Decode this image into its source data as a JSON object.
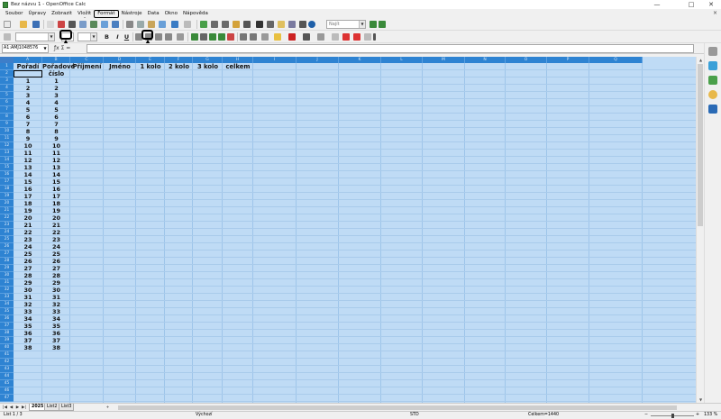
{
  "window": {
    "title": "Bez názvu 1 - OpenOffice Calc",
    "minimize": "—",
    "maximize": "□",
    "close": "✕",
    "doc_close": "×"
  },
  "menu": [
    "Soubor",
    "Úpravy",
    "Zobrazit",
    "Vložit",
    "Formát",
    "Nástroje",
    "Data",
    "Okno",
    "Nápověda"
  ],
  "highlighted_menu": "Formát",
  "toolbar": {
    "find_placeholder": "Najít"
  },
  "format_buttons": {
    "bold": "B",
    "italic": "I",
    "underline": "U"
  },
  "formula_bar": {
    "name_box": "A1:AMJ1048576",
    "fx": "ƒx Σ ="
  },
  "columns": [
    "A",
    "B",
    "C",
    "D",
    "E",
    "F",
    "G",
    "H",
    "I",
    "J",
    "K",
    "L",
    "M",
    "N",
    "O",
    "P",
    "Q"
  ],
  "header_row": [
    "Pořadí",
    "Pořadové",
    "Příjmení",
    "Jméno",
    "1 kolo",
    "2 kolo",
    "3 kolo",
    "celkem"
  ],
  "header_row2": [
    "",
    "číslo"
  ],
  "data_rows": [
    [
      "",
      ""
    ],
    [
      "1",
      "1"
    ],
    [
      "2",
      "2"
    ],
    [
      "3",
      "3"
    ],
    [
      "4",
      "4"
    ],
    [
      "5",
      "5"
    ],
    [
      "6",
      "6"
    ],
    [
      "7",
      "7"
    ],
    [
      "8",
      "8"
    ],
    [
      "9",
      "9"
    ],
    [
      "10",
      "10"
    ],
    [
      "11",
      "11"
    ],
    [
      "12",
      "12"
    ],
    [
      "13",
      "13"
    ],
    [
      "14",
      "14"
    ],
    [
      "15",
      "15"
    ],
    [
      "16",
      "16"
    ],
    [
      "17",
      "17"
    ],
    [
      "18",
      "18"
    ],
    [
      "19",
      "19"
    ],
    [
      "20",
      "20"
    ],
    [
      "21",
      "21"
    ],
    [
      "22",
      "22"
    ],
    [
      "23",
      "23"
    ],
    [
      "24",
      "24"
    ],
    [
      "25",
      "25"
    ],
    [
      "26",
      "26"
    ],
    [
      "27",
      "27"
    ],
    [
      "28",
      "28"
    ],
    [
      "29",
      "29"
    ],
    [
      "30",
      "30"
    ],
    [
      "31",
      "31"
    ],
    [
      "32",
      "32"
    ],
    [
      "33",
      "33"
    ],
    [
      "34",
      "34"
    ],
    [
      "35",
      "35"
    ],
    [
      "36",
      "36"
    ],
    [
      "37",
      "37"
    ],
    [
      "38",
      "38"
    ]
  ],
  "row_numbers": [
    "1",
    "2",
    "3",
    "4",
    "5",
    "6",
    "7",
    "8",
    "9",
    "10",
    "11",
    "12",
    "13",
    "14",
    "15",
    "16",
    "17",
    "18",
    "19",
    "20",
    "21",
    "22",
    "23",
    "24",
    "25",
    "26",
    "27",
    "28",
    "29",
    "30",
    "31",
    "32",
    "33",
    "34",
    "35",
    "36",
    "37",
    "38",
    "39",
    "40",
    "41",
    "42",
    "43",
    "44",
    "45",
    "46",
    "47"
  ],
  "sheet_tabs": [
    "2025",
    "List2",
    "List3"
  ],
  "add_sheet": "+",
  "status": {
    "sheet": "List 1 / 3",
    "style": "Výchozí",
    "mode": "STD",
    "sum": "Celkem=1440",
    "zoom": "133 %"
  },
  "colors": {
    "selection": "#bfdbf5",
    "header": "#2e83d2"
  }
}
